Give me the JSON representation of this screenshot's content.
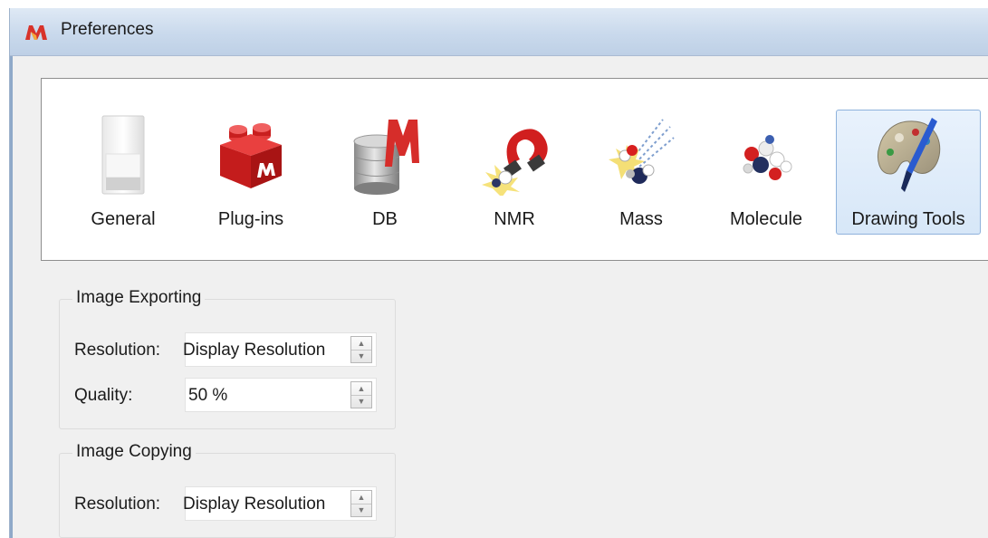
{
  "window": {
    "title": "Preferences",
    "app_icon": "mestrenova-logo-icon"
  },
  "toolbar": {
    "items": [
      {
        "label": "General",
        "icon": "general-switch-icon",
        "selected": false
      },
      {
        "label": "Plug-ins",
        "icon": "plugin-brick-icon",
        "selected": false
      },
      {
        "label": "DB",
        "icon": "database-icon",
        "selected": false
      },
      {
        "label": "NMR",
        "icon": "magnet-icon",
        "selected": false
      },
      {
        "label": "Mass",
        "icon": "mass-spec-icon",
        "selected": false
      },
      {
        "label": "Molecule",
        "icon": "molecule-icon",
        "selected": false
      },
      {
        "label": "Drawing Tools",
        "icon": "palette-icon",
        "selected": true
      }
    ]
  },
  "image_exporting": {
    "title": "Image Exporting",
    "resolution_label": "Resolution:",
    "resolution_value": "Display Resolution",
    "quality_label": "Quality:",
    "quality_value": "50 %"
  },
  "image_copying": {
    "title": "Image Copying",
    "resolution_label": "Resolution:",
    "resolution_value": "Display Resolution"
  }
}
